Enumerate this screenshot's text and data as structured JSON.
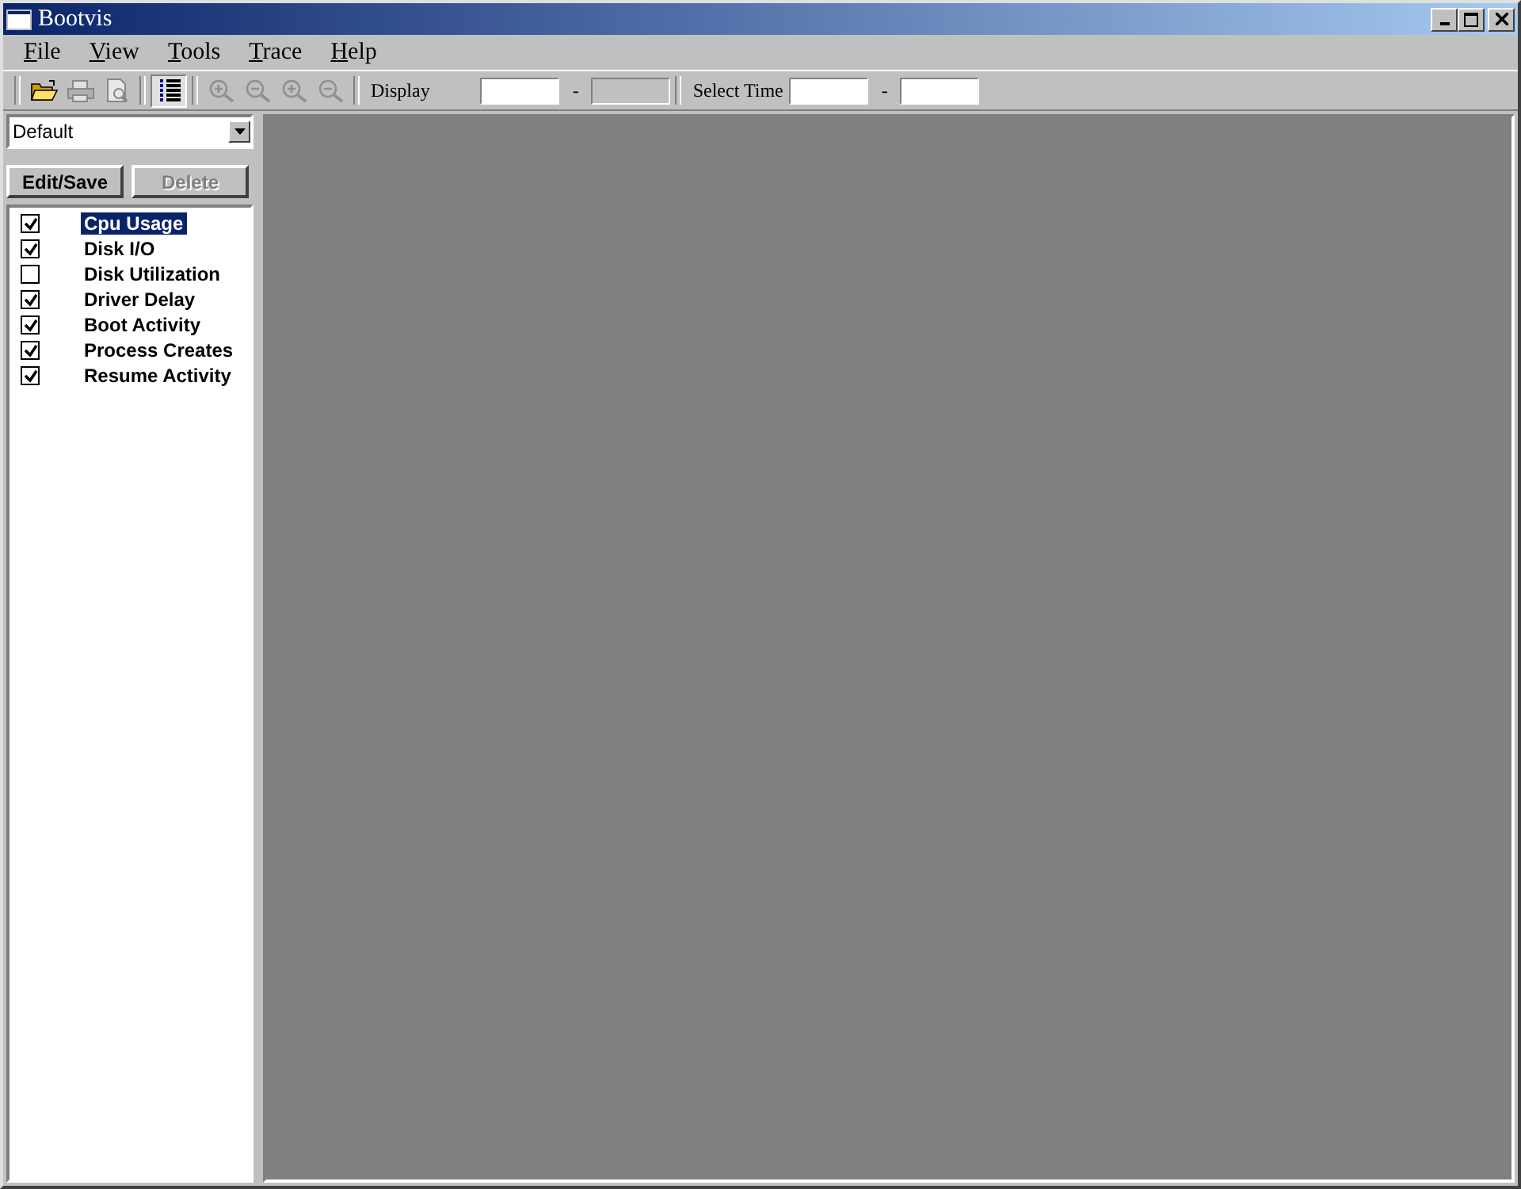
{
  "window": {
    "title": "Bootvis"
  },
  "menu": [
    {
      "label": "File"
    },
    {
      "label": "View"
    },
    {
      "label": "Tools"
    },
    {
      "label": "Trace"
    },
    {
      "label": "Help"
    }
  ],
  "toolbar": {
    "display_label": "Display",
    "display_fields": [
      {
        "disabled": false
      },
      {
        "disabled": true
      }
    ],
    "display_separator": "-",
    "select_time_label": "Select Time",
    "select_time_fields": [
      {
        "disabled": false
      },
      {
        "disabled": false
      }
    ],
    "select_time_separator": "-",
    "list_view_on": true
  },
  "profile": {
    "value": "Default"
  },
  "buttons": [
    {
      "label": "Edit/Save",
      "disabled": false
    },
    {
      "label": "Delete",
      "disabled": true
    }
  ],
  "graphs": [
    {
      "label": "Cpu Usage",
      "checked": true,
      "selected": true
    },
    {
      "label": "Disk I/O",
      "checked": true,
      "selected": false
    },
    {
      "label": "Disk Utilization",
      "checked": false,
      "selected": false
    },
    {
      "label": "Driver Delay",
      "checked": true,
      "selected": false
    },
    {
      "label": "Boot Activity",
      "checked": true,
      "selected": false
    },
    {
      "label": "Process Creates",
      "checked": true,
      "selected": false
    },
    {
      "label": "Resume Activity",
      "checked": true,
      "selected": false
    }
  ]
}
